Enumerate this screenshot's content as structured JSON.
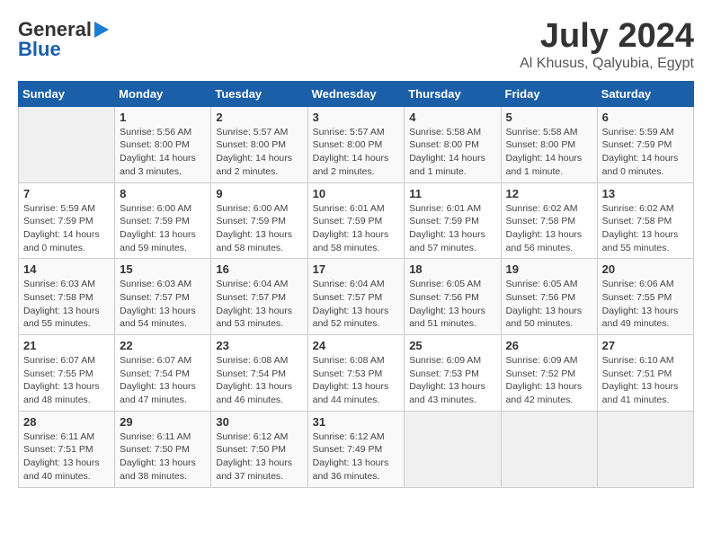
{
  "header": {
    "logo_general": "General",
    "logo_blue": "Blue",
    "title": "July 2024",
    "subtitle": "Al Khusus, Qalyubia, Egypt"
  },
  "columns": [
    "Sunday",
    "Monday",
    "Tuesday",
    "Wednesday",
    "Thursday",
    "Friday",
    "Saturday"
  ],
  "weeks": [
    [
      {
        "day": "",
        "lines": []
      },
      {
        "day": "1",
        "lines": [
          "Sunrise: 5:56 AM",
          "Sunset: 8:00 PM",
          "Daylight: 14 hours",
          "and 3 minutes."
        ]
      },
      {
        "day": "2",
        "lines": [
          "Sunrise: 5:57 AM",
          "Sunset: 8:00 PM",
          "Daylight: 14 hours",
          "and 2 minutes."
        ]
      },
      {
        "day": "3",
        "lines": [
          "Sunrise: 5:57 AM",
          "Sunset: 8:00 PM",
          "Daylight: 14 hours",
          "and 2 minutes."
        ]
      },
      {
        "day": "4",
        "lines": [
          "Sunrise: 5:58 AM",
          "Sunset: 8:00 PM",
          "Daylight: 14 hours",
          "and 1 minute."
        ]
      },
      {
        "day": "5",
        "lines": [
          "Sunrise: 5:58 AM",
          "Sunset: 8:00 PM",
          "Daylight: 14 hours",
          "and 1 minute."
        ]
      },
      {
        "day": "6",
        "lines": [
          "Sunrise: 5:59 AM",
          "Sunset: 7:59 PM",
          "Daylight: 14 hours",
          "and 0 minutes."
        ]
      }
    ],
    [
      {
        "day": "7",
        "lines": [
          "Sunrise: 5:59 AM",
          "Sunset: 7:59 PM",
          "Daylight: 14 hours",
          "and 0 minutes."
        ]
      },
      {
        "day": "8",
        "lines": [
          "Sunrise: 6:00 AM",
          "Sunset: 7:59 PM",
          "Daylight: 13 hours",
          "and 59 minutes."
        ]
      },
      {
        "day": "9",
        "lines": [
          "Sunrise: 6:00 AM",
          "Sunset: 7:59 PM",
          "Daylight: 13 hours",
          "and 58 minutes."
        ]
      },
      {
        "day": "10",
        "lines": [
          "Sunrise: 6:01 AM",
          "Sunset: 7:59 PM",
          "Daylight: 13 hours",
          "and 58 minutes."
        ]
      },
      {
        "day": "11",
        "lines": [
          "Sunrise: 6:01 AM",
          "Sunset: 7:59 PM",
          "Daylight: 13 hours",
          "and 57 minutes."
        ]
      },
      {
        "day": "12",
        "lines": [
          "Sunrise: 6:02 AM",
          "Sunset: 7:58 PM",
          "Daylight: 13 hours",
          "and 56 minutes."
        ]
      },
      {
        "day": "13",
        "lines": [
          "Sunrise: 6:02 AM",
          "Sunset: 7:58 PM",
          "Daylight: 13 hours",
          "and 55 minutes."
        ]
      }
    ],
    [
      {
        "day": "14",
        "lines": [
          "Sunrise: 6:03 AM",
          "Sunset: 7:58 PM",
          "Daylight: 13 hours",
          "and 55 minutes."
        ]
      },
      {
        "day": "15",
        "lines": [
          "Sunrise: 6:03 AM",
          "Sunset: 7:57 PM",
          "Daylight: 13 hours",
          "and 54 minutes."
        ]
      },
      {
        "day": "16",
        "lines": [
          "Sunrise: 6:04 AM",
          "Sunset: 7:57 PM",
          "Daylight: 13 hours",
          "and 53 minutes."
        ]
      },
      {
        "day": "17",
        "lines": [
          "Sunrise: 6:04 AM",
          "Sunset: 7:57 PM",
          "Daylight: 13 hours",
          "and 52 minutes."
        ]
      },
      {
        "day": "18",
        "lines": [
          "Sunrise: 6:05 AM",
          "Sunset: 7:56 PM",
          "Daylight: 13 hours",
          "and 51 minutes."
        ]
      },
      {
        "day": "19",
        "lines": [
          "Sunrise: 6:05 AM",
          "Sunset: 7:56 PM",
          "Daylight: 13 hours",
          "and 50 minutes."
        ]
      },
      {
        "day": "20",
        "lines": [
          "Sunrise: 6:06 AM",
          "Sunset: 7:55 PM",
          "Daylight: 13 hours",
          "and 49 minutes."
        ]
      }
    ],
    [
      {
        "day": "21",
        "lines": [
          "Sunrise: 6:07 AM",
          "Sunset: 7:55 PM",
          "Daylight: 13 hours",
          "and 48 minutes."
        ]
      },
      {
        "day": "22",
        "lines": [
          "Sunrise: 6:07 AM",
          "Sunset: 7:54 PM",
          "Daylight: 13 hours",
          "and 47 minutes."
        ]
      },
      {
        "day": "23",
        "lines": [
          "Sunrise: 6:08 AM",
          "Sunset: 7:54 PM",
          "Daylight: 13 hours",
          "and 46 minutes."
        ]
      },
      {
        "day": "24",
        "lines": [
          "Sunrise: 6:08 AM",
          "Sunset: 7:53 PM",
          "Daylight: 13 hours",
          "and 44 minutes."
        ]
      },
      {
        "day": "25",
        "lines": [
          "Sunrise: 6:09 AM",
          "Sunset: 7:53 PM",
          "Daylight: 13 hours",
          "and 43 minutes."
        ]
      },
      {
        "day": "26",
        "lines": [
          "Sunrise: 6:09 AM",
          "Sunset: 7:52 PM",
          "Daylight: 13 hours",
          "and 42 minutes."
        ]
      },
      {
        "day": "27",
        "lines": [
          "Sunrise: 6:10 AM",
          "Sunset: 7:51 PM",
          "Daylight: 13 hours",
          "and 41 minutes."
        ]
      }
    ],
    [
      {
        "day": "28",
        "lines": [
          "Sunrise: 6:11 AM",
          "Sunset: 7:51 PM",
          "Daylight: 13 hours",
          "and 40 minutes."
        ]
      },
      {
        "day": "29",
        "lines": [
          "Sunrise: 6:11 AM",
          "Sunset: 7:50 PM",
          "Daylight: 13 hours",
          "and 38 minutes."
        ]
      },
      {
        "day": "30",
        "lines": [
          "Sunrise: 6:12 AM",
          "Sunset: 7:50 PM",
          "Daylight: 13 hours",
          "and 37 minutes."
        ]
      },
      {
        "day": "31",
        "lines": [
          "Sunrise: 6:12 AM",
          "Sunset: 7:49 PM",
          "Daylight: 13 hours",
          "and 36 minutes."
        ]
      },
      {
        "day": "",
        "lines": []
      },
      {
        "day": "",
        "lines": []
      },
      {
        "day": "",
        "lines": []
      }
    ]
  ]
}
